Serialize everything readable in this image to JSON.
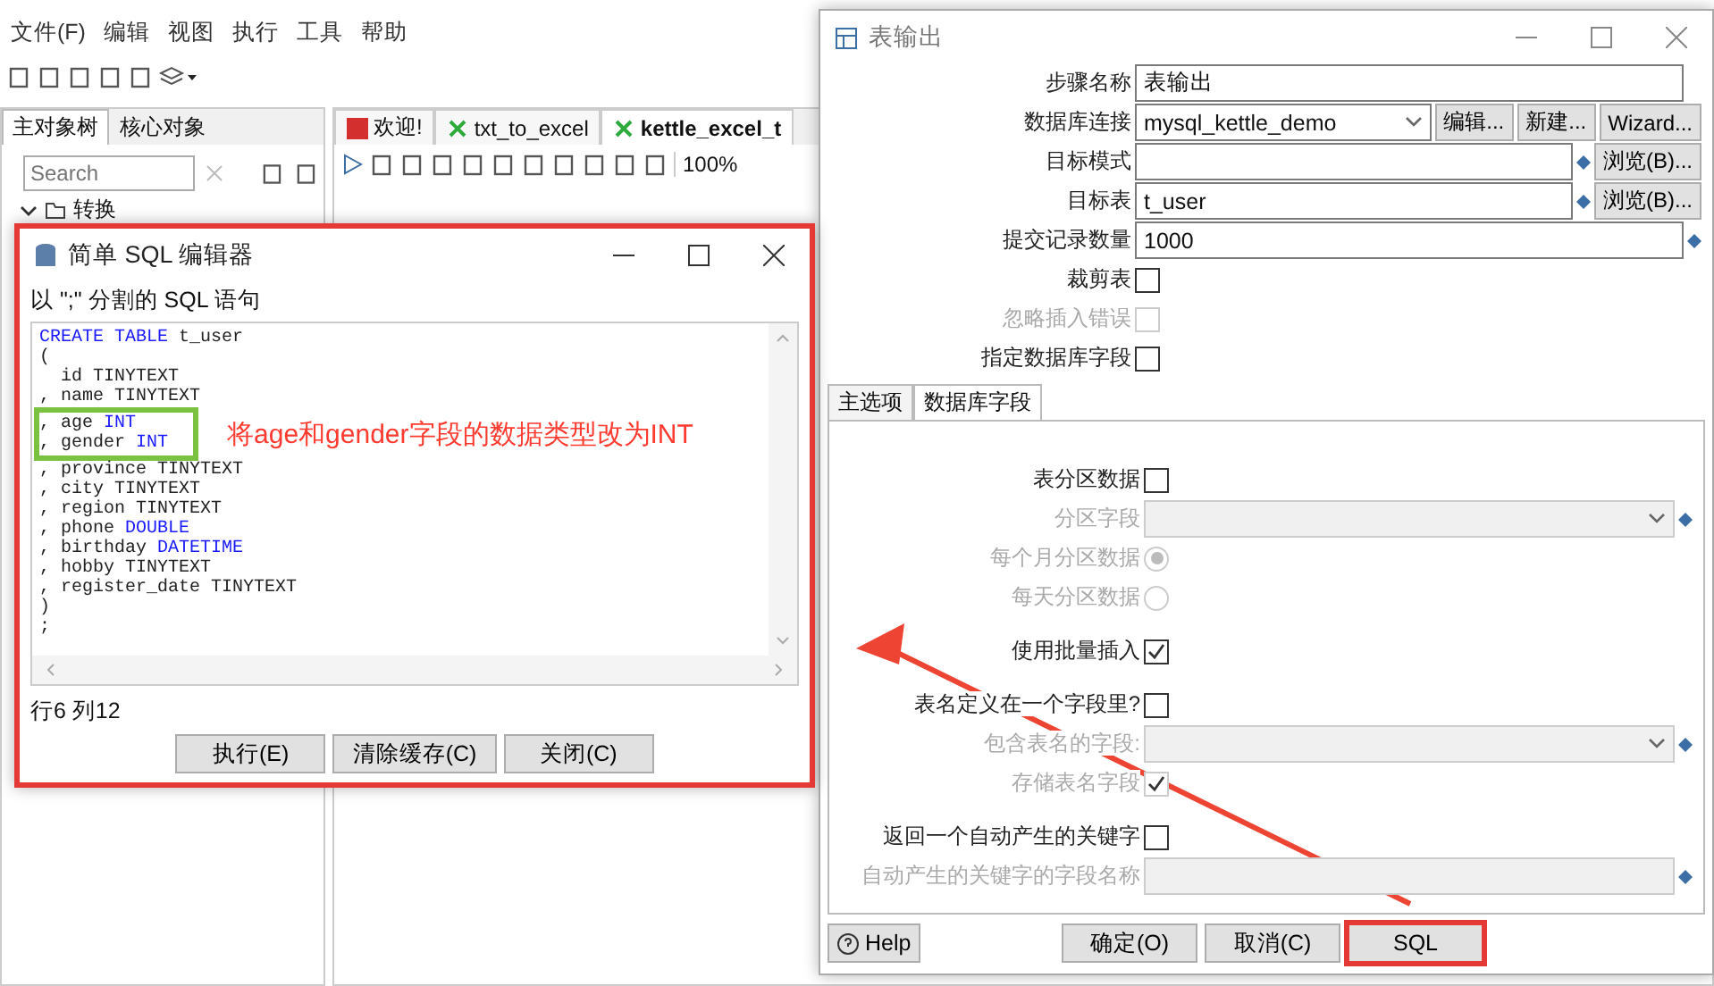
{
  "menu": [
    "文件(F)",
    "编辑",
    "视图",
    "执行",
    "工具",
    "帮助"
  ],
  "left_tabs": [
    {
      "label": "主对象树",
      "selected": true
    },
    {
      "label": "核心对象",
      "selected": false
    }
  ],
  "search": {
    "placeholder": "Search"
  },
  "tree": [
    {
      "label": "转换",
      "expanded": true
    }
  ],
  "editor_tabs": [
    {
      "label": "欢迎!",
      "kind": "welcome",
      "selected": false
    },
    {
      "label": "txt_to_excel",
      "kind": "transform",
      "selected": false
    },
    {
      "label": "kettle_excel_t",
      "kind": "transform",
      "selected": true
    }
  ],
  "zoom": "100%",
  "sql_editor": {
    "title": "简单 SQL 编辑器",
    "hint": "以 \";\" 分割的 SQL 语句",
    "lines": [
      {
        "boxed": false,
        "segments": [
          {
            "text": "CREATE TABLE",
            "keyword": true
          },
          {
            "text": " t_user",
            "keyword": false
          }
        ]
      },
      {
        "boxed": false,
        "segments": [
          {
            "text": "(",
            "keyword": false
          }
        ]
      },
      {
        "boxed": false,
        "segments": [
          {
            "text": "  id TINYTEXT",
            "keyword": false
          }
        ]
      },
      {
        "boxed": false,
        "segments": [
          {
            "text": ", name TINYTEXT",
            "keyword": false
          }
        ]
      },
      {
        "boxed": true,
        "segments": [
          {
            "text": ", age ",
            "keyword": false
          },
          {
            "text": "INT",
            "keyword": true
          }
        ]
      },
      {
        "boxed": true,
        "segments": [
          {
            "text": ", gender ",
            "keyword": false
          },
          {
            "text": "INT",
            "keyword": true
          }
        ]
      },
      {
        "boxed": false,
        "segments": [
          {
            "text": ", province TINYTEXT",
            "keyword": false
          }
        ]
      },
      {
        "boxed": false,
        "segments": [
          {
            "text": ", city TINYTEXT",
            "keyword": false
          }
        ]
      },
      {
        "boxed": false,
        "segments": [
          {
            "text": ", region TINYTEXT",
            "keyword": false
          }
        ]
      },
      {
        "boxed": false,
        "segments": [
          {
            "text": ", phone ",
            "keyword": false
          },
          {
            "text": "DOUBLE",
            "keyword": true
          }
        ]
      },
      {
        "boxed": false,
        "segments": [
          {
            "text": ", birthday ",
            "keyword": false
          },
          {
            "text": "DATETIME",
            "keyword": true
          }
        ]
      },
      {
        "boxed": false,
        "segments": [
          {
            "text": ", hobby TINYTEXT",
            "keyword": false
          }
        ]
      },
      {
        "boxed": false,
        "segments": [
          {
            "text": ", register_date TINYTEXT",
            "keyword": false
          }
        ]
      },
      {
        "boxed": false,
        "segments": [
          {
            "text": ")",
            "keyword": false
          }
        ]
      },
      {
        "boxed": false,
        "segments": [
          {
            "text": ";",
            "keyword": false
          }
        ]
      }
    ],
    "status": "行6 列12",
    "buttons": [
      "执行(E)",
      "清除缓存(C)",
      "关闭(C)"
    ]
  },
  "annotation": {
    "note": "将age和gender字段的数据类型改为INT"
  },
  "table_output": {
    "title": "表输出",
    "fields": [
      {
        "kind": "text",
        "label": "步骤名称",
        "value": "表输出"
      },
      {
        "kind": "combo",
        "label": "数据库连接",
        "value": "mysql_kettle_demo",
        "buttons": [
          "编辑...",
          "新建...",
          "Wizard..."
        ]
      },
      {
        "kind": "browse",
        "label": "目标模式",
        "button": "浏览(B)..."
      },
      {
        "kind": "browse",
        "label": "目标表",
        "value": "t_user",
        "button": "浏览(B)..."
      },
      {
        "kind": "variable",
        "label": "提交记录数量",
        "value": "1000"
      },
      {
        "kind": "check",
        "label": "裁剪表",
        "checked": false,
        "disabled": false
      },
      {
        "kind": "check",
        "label": "忽略插入错误",
        "checked": false,
        "disabled": true
      },
      {
        "kind": "check",
        "label": "指定数据库字段",
        "checked": false,
        "disabled": false
      }
    ],
    "tabs": [
      {
        "label": "主选项",
        "selected": true
      },
      {
        "label": "数据库字段",
        "selected": false
      }
    ],
    "groups": [
      [
        {
          "kind": "check",
          "label": "表分区数据",
          "checked": false,
          "disabled": false
        },
        {
          "kind": "combo",
          "label": "分区字段",
          "disabled": true
        },
        {
          "kind": "radio",
          "label": "每个月分区数据",
          "selected": true,
          "disabled": true
        },
        {
          "kind": "radio",
          "label": "每天分区数据",
          "selected": false,
          "disabled": true
        }
      ],
      [
        {
          "kind": "check",
          "label": "使用批量插入",
          "checked": true,
          "disabled": false
        }
      ],
      [
        {
          "kind": "check",
          "label": "表名定义在一个字段里?",
          "checked": false,
          "disabled": false
        },
        {
          "kind": "combo",
          "label": "包含表名的字段:",
          "disabled": true
        },
        {
          "kind": "check",
          "label": "存储表名字段",
          "checked": true,
          "disabled": true
        }
      ],
      [
        {
          "kind": "check",
          "label": "返回一个自动产生的关键字",
          "checked": false,
          "disabled": false
        },
        {
          "kind": "text",
          "label": "自动产生的关键字的字段名称",
          "disabled": true
        }
      ]
    ],
    "help": "Help",
    "buttons": [
      {
        "label": "确定(O)",
        "highlighted": false
      },
      {
        "label": "取消(C)",
        "highlighted": false
      },
      {
        "label": "SQL",
        "highlighted": true
      }
    ]
  }
}
